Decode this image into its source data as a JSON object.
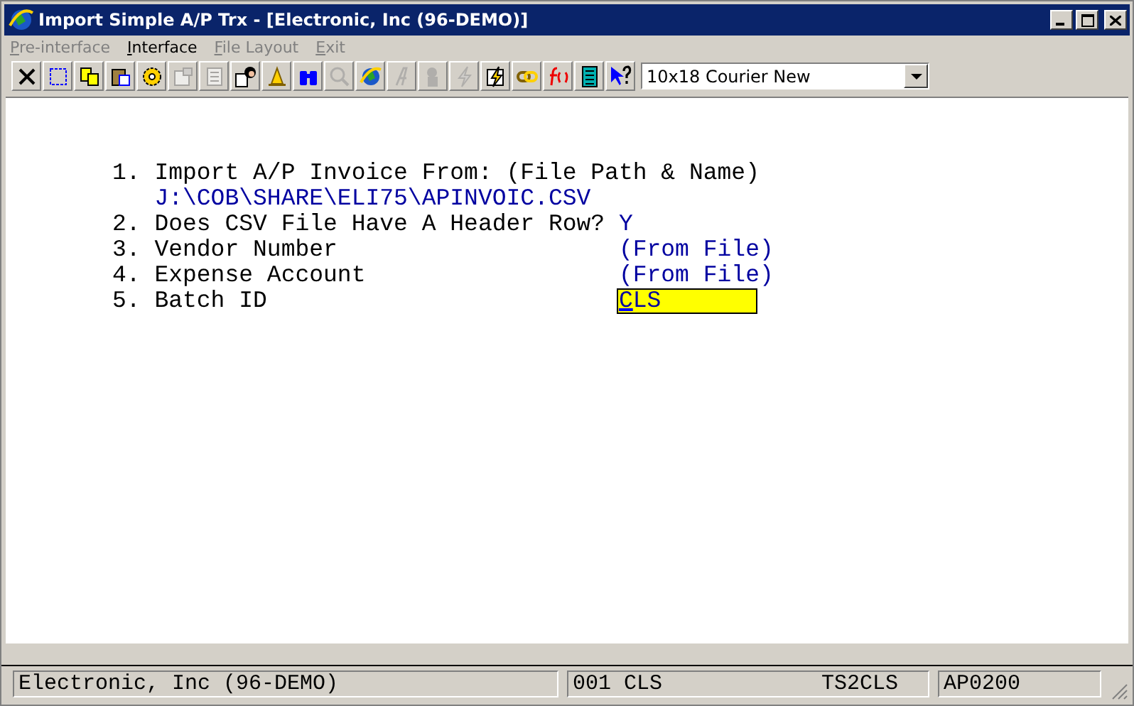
{
  "window": {
    "title": "Import Simple A/P Trx - [Electronic, Inc (96-DEMO)]"
  },
  "menu": [
    {
      "label": "Pre-interface",
      "disabled": true
    },
    {
      "label": "Interface",
      "disabled": false
    },
    {
      "label": "File Layout",
      "disabled": true
    },
    {
      "label": "Exit",
      "disabled": true
    }
  ],
  "toolbar": [
    {
      "disabled": false
    },
    {
      "disabled": false
    },
    {
      "disabled": false
    },
    {
      "disabled": false
    },
    {
      "disabled": false
    },
    {
      "disabled": true
    },
    {
      "disabled": true
    },
    {
      "disabled": false
    },
    {
      "disabled": false
    },
    {
      "disabled": false
    },
    {
      "disabled": true
    },
    {
      "disabled": false
    },
    {
      "disabled": true
    },
    {
      "disabled": true
    },
    {
      "disabled": true
    },
    {
      "disabled": false
    },
    {
      "disabled": false
    },
    {
      "disabled": false
    },
    {
      "disabled": false
    },
    {
      "disabled": false
    }
  ],
  "font_select": {
    "value": "10x18 Courier New"
  },
  "form": [
    {
      "number": "1.",
      "label": "Import A/P Invoice From: (File Path & Name)",
      "kind": "path",
      "value": "J:\\COB\\SHARE\\ELI75\\APINVOIC.CSV"
    },
    {
      "number": "2.",
      "label": "Does CSV File Have A Header Row?",
      "kind": "inline",
      "value": "Y"
    },
    {
      "number": "3.",
      "label": "Vendor Number",
      "kind": "column",
      "value": "(From File)"
    },
    {
      "number": "4.",
      "label": "Expense Account",
      "kind": "column",
      "value": "(From File)"
    },
    {
      "number": "5.",
      "label": "Batch ID",
      "kind": "input",
      "value": "CLS"
    }
  ],
  "status_bar": {
    "company": "Electronic, Inc (96-DEMO)",
    "batch": "001 CLS",
    "user": "TS2CLS",
    "program": "AP0200"
  }
}
